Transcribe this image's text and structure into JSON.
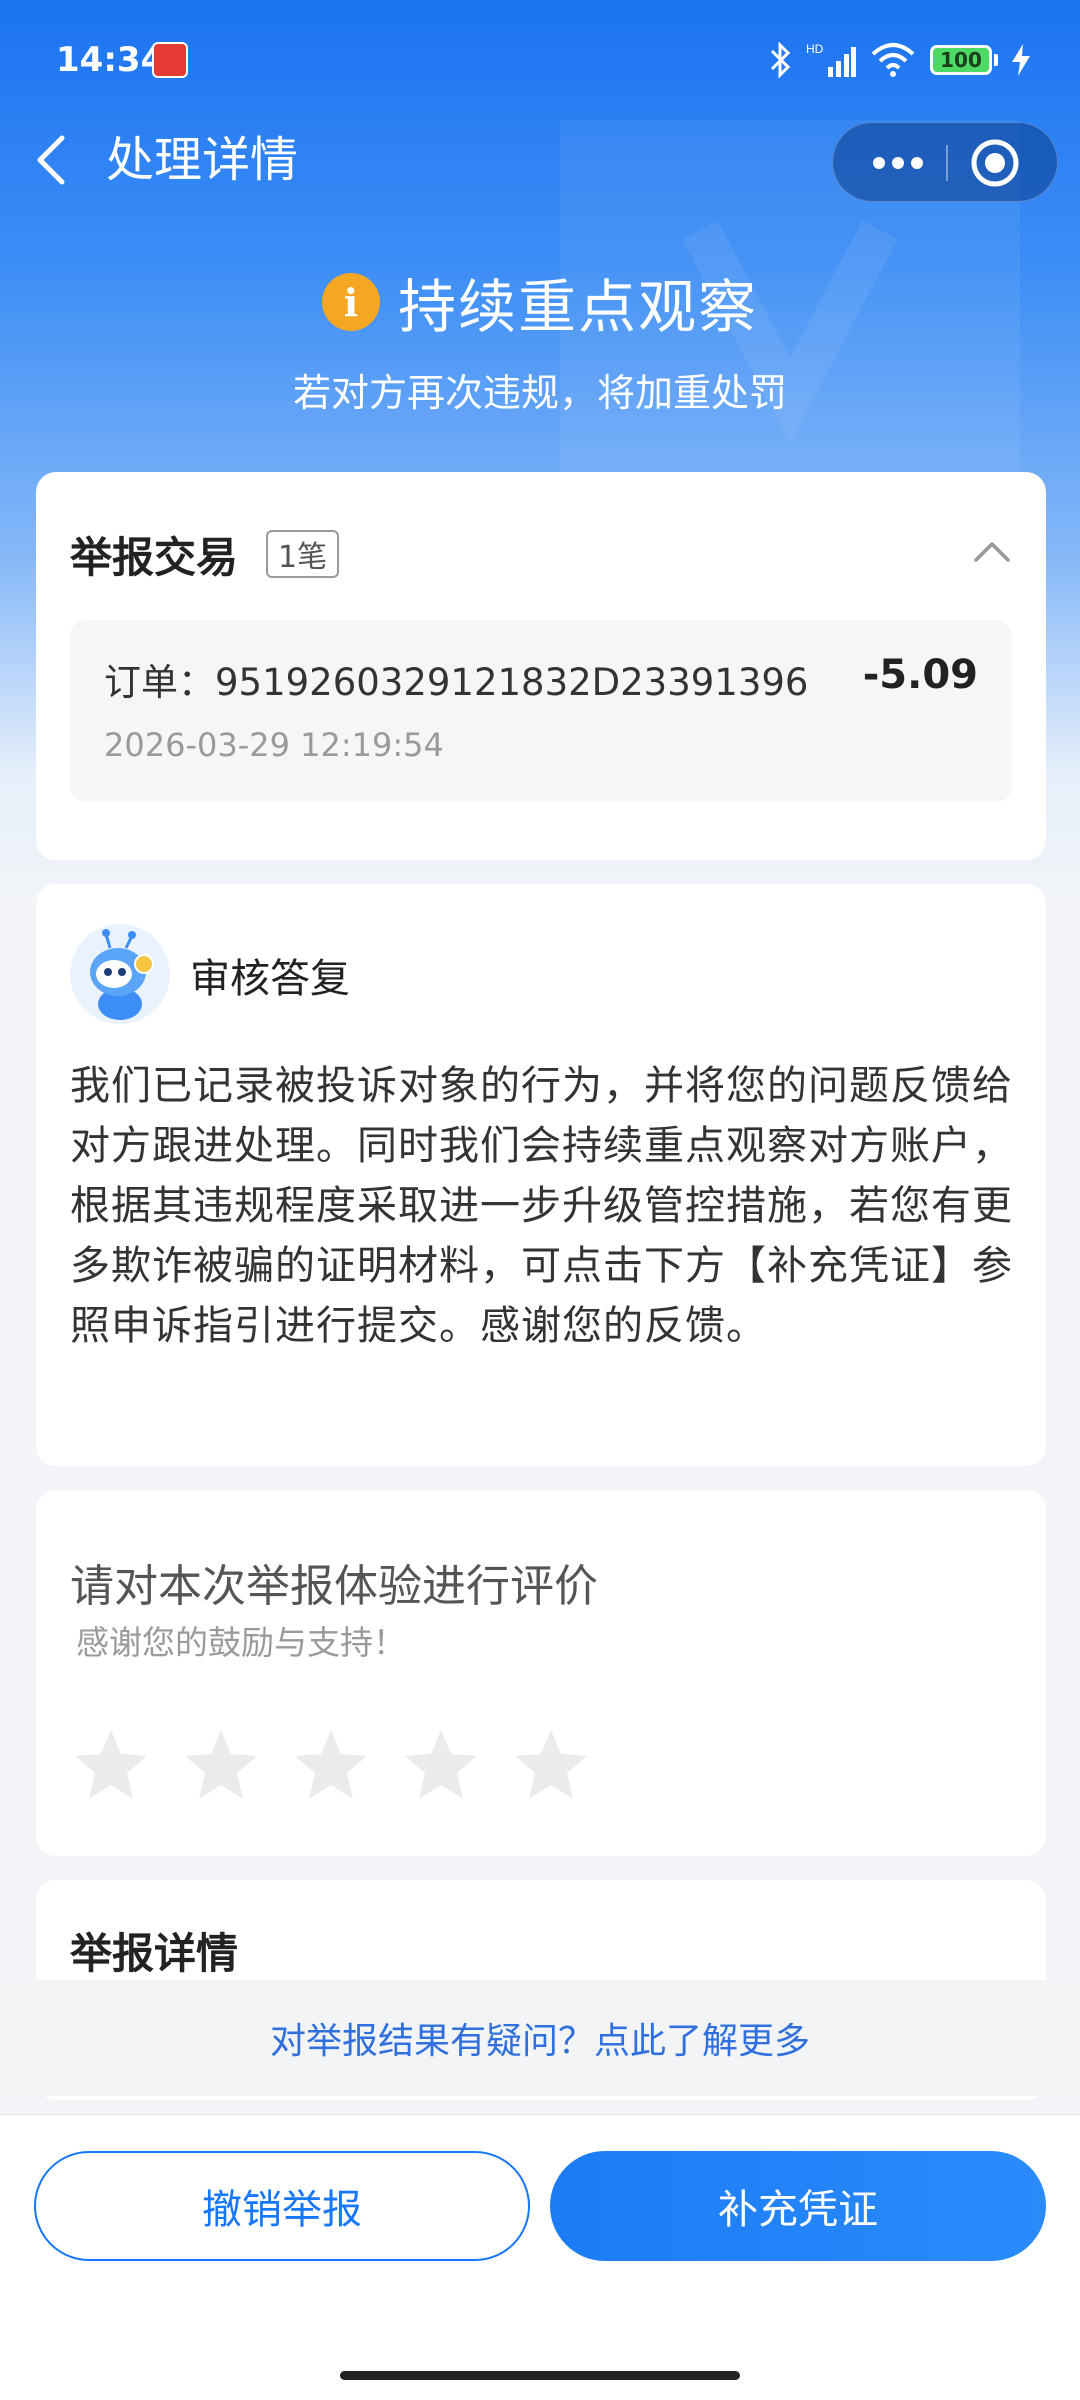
{
  "status_bar": {
    "time": "14:34",
    "battery": "100"
  },
  "nav": {
    "title": "处理详情"
  },
  "result": {
    "title": "持续重点观察",
    "subtitle": "若对方再次违规，将加重处罚",
    "icon_glyph": "i"
  },
  "trade": {
    "title": "举报交易",
    "count": "1笔",
    "order_label": "订单：9519260329121832D23391396",
    "amount": "-5.09",
    "time": "2026-03-29 12:19:54"
  },
  "reply": {
    "title": "审核答复",
    "text": "我们已记录被投诉对象的行为，并将您的问题反馈给对方跟进处理。同时我们会持续重点观察对方账户，根据其违规程度采取进一步升级管控措施，若您有更多欺诈被骗的证明材料，可点击下方【补充凭证】参照申诉指引进行提交。感谢您的反馈。"
  },
  "rating": {
    "title": "请对本次举报体验进行评价",
    "subtitle": "感谢您的鼓励与支持！",
    "max_stars": 5,
    "selected_stars": 0
  },
  "detail": {
    "title": "举报详情"
  },
  "doubt_link": "对举报结果有疑问？点此了解更多",
  "buttons": {
    "cancel": "撤销举报",
    "supplement": "补充凭证"
  },
  "colors": {
    "primary": "#1677ff",
    "warning": "#f5a623",
    "link": "#2f6fde"
  },
  "icons": [
    "back-icon",
    "more-icon",
    "close-icon",
    "info-icon",
    "chevron-up-icon",
    "star-icon",
    "bluetooth-icon",
    "signal-icon",
    "wifi-icon",
    "battery-icon",
    "charging-icon"
  ]
}
